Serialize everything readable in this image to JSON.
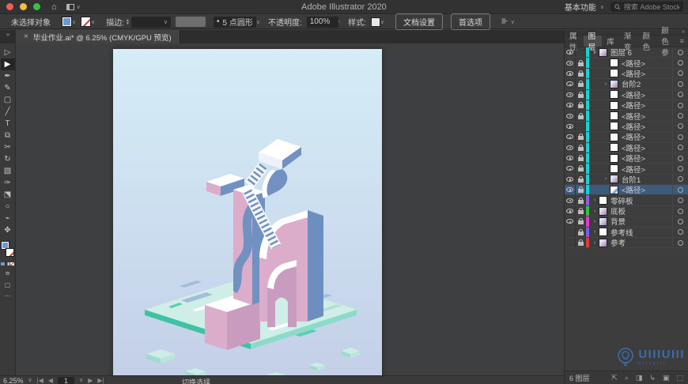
{
  "titlebar": {
    "title": "Adobe Illustrator 2020",
    "workspace_menu": "基本功能",
    "search_placeholder": "搜索 Adobe Stock"
  },
  "options_bar": {
    "selection_status": "未选择对象",
    "stroke_label": "描边:",
    "brush_bullet": "•",
    "brush_name": "5 点圆形",
    "opacity_label": "不透明度:",
    "opacity_value": "100%",
    "opacity_chevron": "›",
    "style_label": "样式:",
    "document_setup_button": "文档设置",
    "preferences_button": "首选项",
    "align_glyph": "⊪"
  },
  "document_tab": {
    "close": "×",
    "title": "毕业作业.ai* @ 6.25% (CMYK/GPU 预览)"
  },
  "toolbar": {
    "collapse": "»",
    "tools": [
      {
        "name": "direct-selection-tool",
        "glyph": "▷",
        "active": false
      },
      {
        "name": "selection-tool",
        "glyph": "▶",
        "active": true
      },
      {
        "name": "pen-tool",
        "glyph": "✒",
        "active": false
      },
      {
        "name": "paintbrush-tool",
        "glyph": "✎",
        "active": false
      },
      {
        "name": "rectangle-tool",
        "glyph": "▢",
        "active": false
      },
      {
        "name": "pencil-tool",
        "glyph": "╱",
        "active": false
      },
      {
        "name": "type-tool",
        "glyph": "T",
        "active": false
      },
      {
        "name": "artboard-tool",
        "glyph": "⧉",
        "active": false
      },
      {
        "name": "scissors-tool",
        "glyph": "✂",
        "active": false
      },
      {
        "name": "rotate-tool",
        "glyph": "↻",
        "active": false
      },
      {
        "name": "gradient-tool",
        "glyph": "▧",
        "active": false
      },
      {
        "name": "eyedropper-tool",
        "glyph": "✑",
        "active": false
      },
      {
        "name": "shear-tool",
        "glyph": "⬔",
        "active": false
      },
      {
        "name": "zoom-tool",
        "glyph": "○",
        "active": false
      },
      {
        "name": "symbol-sprayer-tool",
        "glyph": "⌁",
        "active": false
      },
      {
        "name": "hand-tool",
        "glyph": "✥",
        "active": false
      }
    ],
    "more_glyph": "⋯"
  },
  "status_bar": {
    "zoom": "6.25%",
    "first": "|◀",
    "prev": "◀",
    "artboard": "1",
    "next": "▶",
    "last": "▶|",
    "hint": "切换选择"
  },
  "right_panel": {
    "collapse": "»",
    "menu_glyph": "≡",
    "tabs": [
      {
        "label": "属性",
        "active": false
      },
      {
        "label": "图层",
        "active": true
      },
      {
        "label": "库",
        "active": false
      },
      {
        "label": "渐变",
        "active": false
      },
      {
        "label": "颜色",
        "active": false
      },
      {
        "label": "颜色参",
        "active": false
      }
    ],
    "layers": [
      {
        "label": "图层 6",
        "eye": true,
        "lock": false,
        "expander": "∨",
        "thumb": "art",
        "indent": 0,
        "selected": false,
        "bar": "#17d3d3"
      },
      {
        "label": "<路径>",
        "eye": true,
        "lock": true,
        "expander": "",
        "thumb": "path",
        "indent": 1,
        "selected": false,
        "bar": "#17d3d3"
      },
      {
        "label": "<路径>",
        "eye": true,
        "lock": true,
        "expander": "",
        "thumb": "path",
        "indent": 1,
        "selected": false,
        "bar": "#17d3d3"
      },
      {
        "label": "台阶2",
        "eye": true,
        "lock": true,
        "expander": "›",
        "thumb": "art",
        "indent": 1,
        "selected": false,
        "bar": "#17d3d3"
      },
      {
        "label": "<路径>",
        "eye": true,
        "lock": true,
        "expander": "",
        "thumb": "path",
        "indent": 1,
        "selected": false,
        "bar": "#17d3d3"
      },
      {
        "label": "<路径>",
        "eye": true,
        "lock": true,
        "expander": "",
        "thumb": "path",
        "indent": 1,
        "selected": false,
        "bar": "#17d3d3"
      },
      {
        "label": "<路径>",
        "eye": true,
        "lock": true,
        "expander": "",
        "thumb": "path",
        "indent": 1,
        "selected": false,
        "bar": "#17d3d3"
      },
      {
        "label": "<路径>",
        "eye": true,
        "lock": false,
        "expander": "",
        "thumb": "path",
        "indent": 1,
        "selected": false,
        "bar": "#17d3d3"
      },
      {
        "label": "<路径>",
        "eye": true,
        "lock": true,
        "expander": "",
        "thumb": "path",
        "indent": 1,
        "selected": false,
        "bar": "#17d3d3"
      },
      {
        "label": "<路径>",
        "eye": true,
        "lock": true,
        "expander": "",
        "thumb": "path",
        "indent": 1,
        "selected": false,
        "bar": "#17d3d3"
      },
      {
        "label": "<路径>",
        "eye": true,
        "lock": true,
        "expander": "",
        "thumb": "path",
        "indent": 1,
        "selected": false,
        "bar": "#17d3d3"
      },
      {
        "label": "<路径>",
        "eye": true,
        "lock": true,
        "expander": "",
        "thumb": "path",
        "indent": 1,
        "selected": false,
        "bar": "#17d3d3"
      },
      {
        "label": "台阶1",
        "eye": true,
        "lock": true,
        "expander": "›",
        "thumb": "art",
        "indent": 1,
        "selected": false,
        "bar": "#17d3d3"
      },
      {
        "label": "<路径>",
        "eye": true,
        "lock": true,
        "expander": "",
        "thumb": "artblue",
        "indent": 1,
        "selected": true,
        "bar": "#17d3d3"
      },
      {
        "label": "零碎板",
        "eye": true,
        "lock": true,
        "expander": "›",
        "thumb": "path",
        "indent": 0,
        "selected": false,
        "bar": "#8a5fe0"
      },
      {
        "label": "底板",
        "eye": true,
        "lock": true,
        "expander": "›",
        "thumb": "art",
        "indent": 0,
        "selected": false,
        "bar": "#31c440"
      },
      {
        "label": "背景",
        "eye": true,
        "lock": true,
        "expander": "›",
        "thumb": "art",
        "indent": 0,
        "selected": false,
        "bar": "#e23bd0"
      },
      {
        "label": "参考线",
        "eye": false,
        "lock": true,
        "expander": "›",
        "thumb": "path",
        "indent": 0,
        "selected": false,
        "bar": "#7a5fe8"
      },
      {
        "label": "参考",
        "eye": false,
        "lock": true,
        "expander": "›",
        "thumb": "art",
        "indent": 0,
        "selected": false,
        "bar": "#e03b3b"
      }
    ],
    "footer": {
      "count": "6 图层",
      "icons": [
        {
          "name": "collect-for-export-icon",
          "glyph": "⇱"
        },
        {
          "name": "locate-object-icon",
          "glyph": "⌕"
        },
        {
          "name": "make-mask-icon",
          "glyph": "◨"
        },
        {
          "name": "new-sublayer-icon",
          "glyph": "↳"
        },
        {
          "name": "new-layer-icon",
          "glyph": "▣"
        },
        {
          "name": "delete-selection-icon",
          "glyph": "⬚"
        }
      ]
    }
  },
  "watermark": {
    "text": "UIIIUIII",
    "subtext": "uiiiuiii"
  },
  "artwork_colors": {
    "background_top": "#d5edf7",
    "background_bottom": "#c3cfe7",
    "pink": "#dcaccb",
    "pink_dark": "#c99cbf",
    "blue": "#7191c1",
    "blue2": "#6d8fc0",
    "white": "#ffffff",
    "platform_top": "#cfeee8",
    "platform_edge": "#3ec2a4",
    "platform_edge_light": "#8adcc9",
    "slot_blue": "#a2bdd8"
  }
}
